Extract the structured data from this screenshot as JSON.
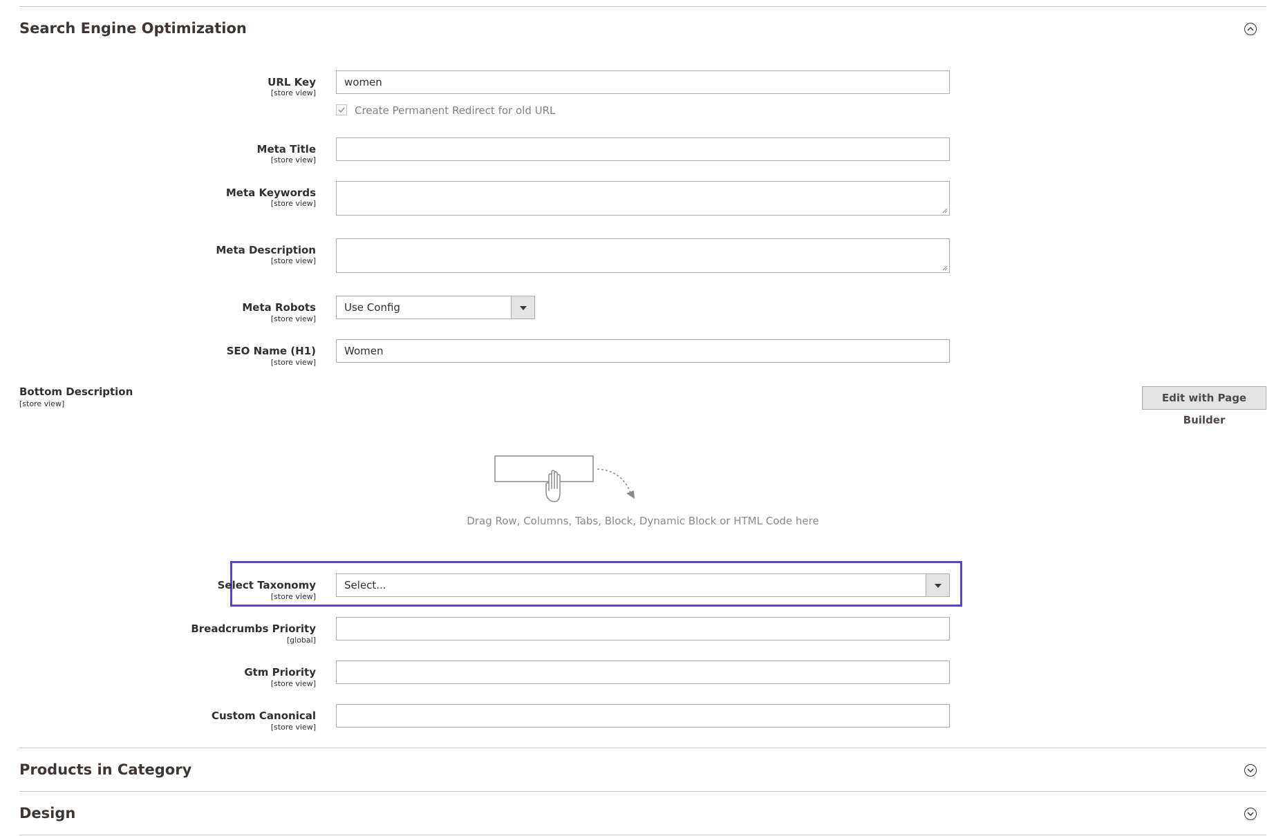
{
  "sections": {
    "seo": {
      "title": "Search Engine Optimization",
      "icon": "chevron-up-icon"
    },
    "products": {
      "title": "Products in Category",
      "icon": "chevron-down-icon"
    },
    "design": {
      "title": "Design",
      "icon": "chevron-down-icon"
    }
  },
  "fields": {
    "url_key": {
      "label": "URL Key",
      "scope": "[store view]",
      "value": "women"
    },
    "redirect": {
      "label": "Create Permanent Redirect for old URL",
      "checked": true
    },
    "meta_title": {
      "label": "Meta Title",
      "scope": "[store view]",
      "value": ""
    },
    "meta_keywords": {
      "label": "Meta Keywords",
      "scope": "[store view]",
      "value": ""
    },
    "meta_description": {
      "label": "Meta Description",
      "scope": "[store view]",
      "value": ""
    },
    "meta_robots": {
      "label": "Meta Robots",
      "scope": "[store view]",
      "value": "Use Config"
    },
    "seo_name": {
      "label": "SEO Name (H1)",
      "scope": "[store view]",
      "value": "Women"
    },
    "bottom_description": {
      "label": "Bottom Description",
      "scope": "[store view]"
    },
    "select_taxonomy": {
      "label": "Select Taxonomy",
      "scope": "[store view]",
      "value": "Select..."
    },
    "breadcrumbs_priority": {
      "label": "Breadcrumbs Priority",
      "scope": "[global]",
      "value": ""
    },
    "gtm_priority": {
      "label": "Gtm Priority",
      "scope": "[store view]",
      "value": ""
    },
    "custom_canonical": {
      "label": "Custom Canonical",
      "scope": "[store view]",
      "value": ""
    }
  },
  "page_builder": {
    "button_label": "Edit with Page Builder",
    "hint": "Drag Row, Columns, Tabs, Block, Dynamic Block or HTML Code here"
  },
  "colors": {
    "highlight": "#5a3fd6",
    "border": "#adadad"
  }
}
